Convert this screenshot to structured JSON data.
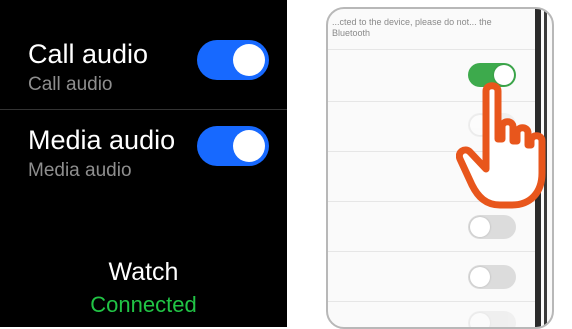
{
  "watch": {
    "rows": [
      {
        "title": "Call audio",
        "subtitle": "Call audio",
        "enabled": true
      },
      {
        "title": "Media audio",
        "subtitle": "Media audio",
        "enabled": true
      }
    ],
    "device": {
      "name": "Watch",
      "status": "Connected"
    },
    "colors": {
      "toggle_on": "#1769ff",
      "status": "#21c445",
      "subtitle": "#8e8e8e"
    }
  },
  "phone": {
    "top_text": "...cted to the device, please do not... the Bluetooth",
    "toggles": [
      {
        "state": "on"
      },
      {
        "state": "off"
      },
      {
        "state": "off"
      },
      {
        "state": "off"
      },
      {
        "state": "off"
      },
      {
        "state": "off"
      }
    ],
    "colors": {
      "toggle_on": "#3daa4c",
      "hand": "#e8561c"
    }
  }
}
